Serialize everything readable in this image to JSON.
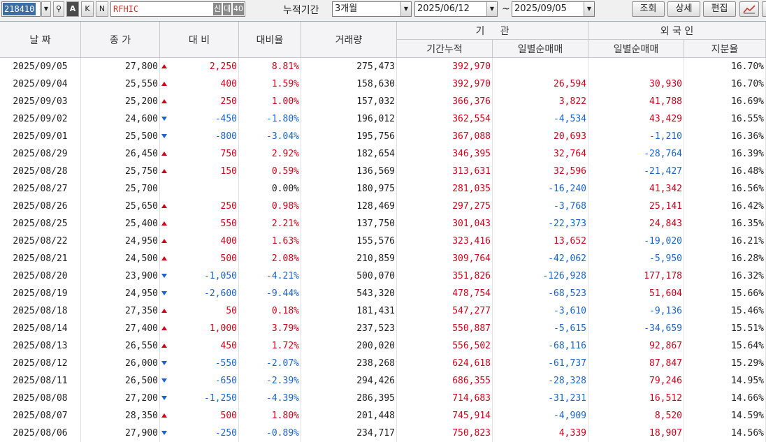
{
  "toolbar": {
    "code": "218410",
    "code_buttons": [
      "A",
      "K",
      "N"
    ],
    "name": "RFHIC",
    "tag1": "신",
    "tag2": "대",
    "tag3": "40",
    "period_label": "누적기간",
    "period_value": "3개월",
    "date_from": "2025/06/12",
    "tilde": "~",
    "date_to": "2025/09/05",
    "btn_query": "조회",
    "btn_detail": "상세",
    "btn_edit": "편집"
  },
  "headers": {
    "date": "날 짜",
    "close": "종 가",
    "change": "대 비",
    "change_rate": "대비율",
    "volume": "거래량",
    "inst": "기     관",
    "inst_cum": "기간누적",
    "inst_daily": "일별순매매",
    "foreign": "외 국 인",
    "foreign_daily": "일별순매매",
    "foreign_share": "지분율"
  },
  "rows": [
    {
      "date": "2025/09/05",
      "close": "27,800",
      "dir": "up",
      "change": "2,250",
      "rate": "8.81%",
      "volume": "275,473",
      "inst_cum": "392,970",
      "inst_daily": "",
      "inst_dir": "bk",
      "f_daily": "",
      "f_dir": "bk",
      "share": "16.70%"
    },
    {
      "date": "2025/09/04",
      "close": "25,550",
      "dir": "up",
      "change": "400",
      "rate": "1.59%",
      "volume": "158,630",
      "inst_cum": "392,970",
      "inst_daily": "26,594",
      "inst_dir": "up",
      "f_daily": "30,930",
      "f_dir": "up",
      "share": "16.70%"
    },
    {
      "date": "2025/09/03",
      "close": "25,200",
      "dir": "up",
      "change": "250",
      "rate": "1.00%",
      "volume": "157,032",
      "inst_cum": "366,376",
      "inst_daily": "3,822",
      "inst_dir": "up",
      "f_daily": "41,788",
      "f_dir": "up",
      "share": "16.69%"
    },
    {
      "date": "2025/09/02",
      "close": "24,600",
      "dir": "dn",
      "change": "-450",
      "rate": "-1.80%",
      "volume": "196,012",
      "inst_cum": "362,554",
      "inst_daily": "-4,534",
      "inst_dir": "dn",
      "f_daily": "43,429",
      "f_dir": "up",
      "share": "16.55%"
    },
    {
      "date": "2025/09/01",
      "close": "25,500",
      "dir": "dn",
      "change": "-800",
      "rate": "-3.04%",
      "volume": "195,756",
      "inst_cum": "367,088",
      "inst_daily": "20,693",
      "inst_dir": "up",
      "f_daily": "-1,210",
      "f_dir": "dn",
      "share": "16.36%"
    },
    {
      "date": "2025/08/29",
      "close": "26,450",
      "dir": "up",
      "change": "750",
      "rate": "2.92%",
      "volume": "182,654",
      "inst_cum": "346,395",
      "inst_daily": "32,764",
      "inst_dir": "up",
      "f_daily": "-28,764",
      "f_dir": "dn",
      "share": "16.39%"
    },
    {
      "date": "2025/08/28",
      "close": "25,750",
      "dir": "up",
      "change": "150",
      "rate": "0.59%",
      "volume": "136,569",
      "inst_cum": "313,631",
      "inst_daily": "32,596",
      "inst_dir": "up",
      "f_daily": "-21,427",
      "f_dir": "dn",
      "share": "16.48%"
    },
    {
      "date": "2025/08/27",
      "close": "25,700",
      "dir": "bk",
      "change": "",
      "rate": "0.00%",
      "volume": "180,975",
      "inst_cum": "281,035",
      "inst_daily": "-16,240",
      "inst_dir": "dn",
      "f_daily": "41,342",
      "f_dir": "up",
      "share": "16.56%"
    },
    {
      "date": "2025/08/26",
      "close": "25,650",
      "dir": "up",
      "change": "250",
      "rate": "0.98%",
      "volume": "128,469",
      "inst_cum": "297,275",
      "inst_daily": "-3,768",
      "inst_dir": "dn",
      "f_daily": "25,141",
      "f_dir": "up",
      "share": "16.42%"
    },
    {
      "date": "2025/08/25",
      "close": "25,400",
      "dir": "up",
      "change": "550",
      "rate": "2.21%",
      "volume": "137,750",
      "inst_cum": "301,043",
      "inst_daily": "-22,373",
      "inst_dir": "dn",
      "f_daily": "24,843",
      "f_dir": "up",
      "share": "16.35%"
    },
    {
      "date": "2025/08/22",
      "close": "24,950",
      "dir": "up",
      "change": "400",
      "rate": "1.63%",
      "volume": "155,576",
      "inst_cum": "323,416",
      "inst_daily": "13,652",
      "inst_dir": "up",
      "f_daily": "-19,020",
      "f_dir": "dn",
      "share": "16.21%"
    },
    {
      "date": "2025/08/21",
      "close": "24,500",
      "dir": "up",
      "change": "500",
      "rate": "2.08%",
      "volume": "210,859",
      "inst_cum": "309,764",
      "inst_daily": "-42,062",
      "inst_dir": "dn",
      "f_daily": "-5,950",
      "f_dir": "dn",
      "share": "16.28%"
    },
    {
      "date": "2025/08/20",
      "close": "23,900",
      "dir": "dn",
      "change": "-1,050",
      "rate": "-4.21%",
      "volume": "500,070",
      "inst_cum": "351,826",
      "inst_daily": "-126,928",
      "inst_dir": "dn",
      "f_daily": "177,178",
      "f_dir": "up",
      "share": "16.32%"
    },
    {
      "date": "2025/08/19",
      "close": "24,950",
      "dir": "dn",
      "change": "-2,600",
      "rate": "-9.44%",
      "volume": "543,320",
      "inst_cum": "478,754",
      "inst_daily": "-68,523",
      "inst_dir": "dn",
      "f_daily": "51,604",
      "f_dir": "up",
      "share": "15.66%"
    },
    {
      "date": "2025/08/18",
      "close": "27,350",
      "dir": "up",
      "change": "50",
      "rate": "0.18%",
      "volume": "181,431",
      "inst_cum": "547,277",
      "inst_daily": "-3,610",
      "inst_dir": "dn",
      "f_daily": "-9,136",
      "f_dir": "dn",
      "share": "15.46%"
    },
    {
      "date": "2025/08/14",
      "close": "27,400",
      "dir": "up",
      "change": "1,000",
      "rate": "3.79%",
      "volume": "237,523",
      "inst_cum": "550,887",
      "inst_daily": "-5,615",
      "inst_dir": "dn",
      "f_daily": "-34,659",
      "f_dir": "dn",
      "share": "15.51%"
    },
    {
      "date": "2025/08/13",
      "close": "26,550",
      "dir": "up",
      "change": "450",
      "rate": "1.72%",
      "volume": "200,020",
      "inst_cum": "556,502",
      "inst_daily": "-68,116",
      "inst_dir": "dn",
      "f_daily": "92,867",
      "f_dir": "up",
      "share": "15.64%"
    },
    {
      "date": "2025/08/12",
      "close": "26,000",
      "dir": "dn",
      "change": "-550",
      "rate": "-2.07%",
      "volume": "238,268",
      "inst_cum": "624,618",
      "inst_daily": "-61,737",
      "inst_dir": "dn",
      "f_daily": "87,847",
      "f_dir": "up",
      "share": "15.29%"
    },
    {
      "date": "2025/08/11",
      "close": "26,500",
      "dir": "dn",
      "change": "-650",
      "rate": "-2.39%",
      "volume": "294,426",
      "inst_cum": "686,355",
      "inst_daily": "-28,328",
      "inst_dir": "dn",
      "f_daily": "79,246",
      "f_dir": "up",
      "share": "14.95%"
    },
    {
      "date": "2025/08/08",
      "close": "27,200",
      "dir": "dn",
      "change": "-1,250",
      "rate": "-4.39%",
      "volume": "286,395",
      "inst_cum": "714,683",
      "inst_daily": "-31,231",
      "inst_dir": "dn",
      "f_daily": "16,512",
      "f_dir": "up",
      "share": "14.66%"
    },
    {
      "date": "2025/08/07",
      "close": "28,350",
      "dir": "up",
      "change": "500",
      "rate": "1.80%",
      "volume": "201,448",
      "inst_cum": "745,914",
      "inst_daily": "-4,909",
      "inst_dir": "dn",
      "f_daily": "8,520",
      "f_dir": "up",
      "share": "14.59%"
    },
    {
      "date": "2025/08/06",
      "close": "27,900",
      "dir": "dn",
      "change": "-250",
      "rate": "-0.89%",
      "volume": "234,717",
      "inst_cum": "750,823",
      "inst_daily": "4,339",
      "inst_dir": "up",
      "f_daily": "18,907",
      "f_dir": "up",
      "share": "14.56%"
    }
  ],
  "colors": {
    "up": "#d0021b",
    "down": "#1a64c8",
    "selection": "#3a6ea5"
  }
}
